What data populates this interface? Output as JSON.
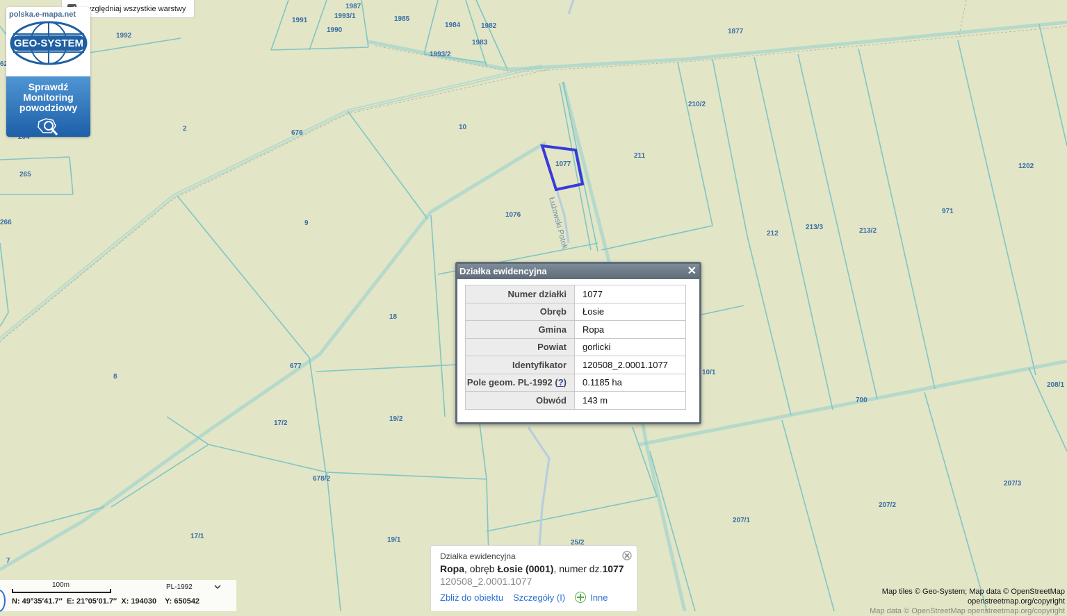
{
  "layers_toggle": {
    "label": "uwzględniaj wszystkie warstwy",
    "checked": true
  },
  "logo": {
    "site": "polska.e-mapa.net",
    "brand": "GEO-SYSTEM",
    "flood_lines": [
      "Sprawdź",
      "Monitoring",
      "powodziowy"
    ]
  },
  "map": {
    "parcel_labels": [
      {
        "id": "l1987",
        "t": "1987"
      },
      {
        "id": "l1993_1",
        "t": "1993/1"
      },
      {
        "id": "l1991",
        "t": "1991"
      },
      {
        "id": "l1990",
        "t": "1990"
      },
      {
        "id": "l1985",
        "t": "1985"
      },
      {
        "id": "l1984",
        "t": "1984"
      },
      {
        "id": "l1982",
        "t": "1982"
      },
      {
        "id": "l1983",
        "t": "1983"
      },
      {
        "id": "l1993_2",
        "t": "1993/2"
      },
      {
        "id": "l1877",
        "t": "1877"
      },
      {
        "id": "l1992",
        "t": "1992"
      },
      {
        "id": "l2",
        "t": "2"
      },
      {
        "id": "l676",
        "t": "676"
      },
      {
        "id": "l10",
        "t": "10"
      },
      {
        "id": "l210_2",
        "t": "210/2"
      },
      {
        "id": "l211",
        "t": "211"
      },
      {
        "id": "l1077",
        "t": "1077"
      },
      {
        "id": "l1202",
        "t": "1202"
      },
      {
        "id": "l265",
        "t": "265"
      },
      {
        "id": "l204",
        "t": "204"
      },
      {
        "id": "l266",
        "t": "266"
      },
      {
        "id": "l9",
        "t": "9"
      },
      {
        "id": "l1076",
        "t": "1076"
      },
      {
        "id": "l971",
        "t": "971"
      },
      {
        "id": "l212",
        "t": "212"
      },
      {
        "id": "l213_3",
        "t": "213/3"
      },
      {
        "id": "l213_2",
        "t": "213/2"
      },
      {
        "id": "l18",
        "t": "18"
      },
      {
        "id": "l677",
        "t": "677"
      },
      {
        "id": "l8",
        "t": "8"
      },
      {
        "id": "l10_1",
        "t": "10/1"
      },
      {
        "id": "l208_1",
        "t": "208/1"
      },
      {
        "id": "l700",
        "t": "700"
      },
      {
        "id": "l17_2",
        "t": "17/2"
      },
      {
        "id": "l19_2",
        "t": "19/2"
      },
      {
        "id": "l678_2",
        "t": "678/2"
      },
      {
        "id": "l207_3",
        "t": "207/3"
      },
      {
        "id": "l207_2",
        "t": "207/2"
      },
      {
        "id": "l207_1",
        "t": "207/1"
      },
      {
        "id": "l17_1",
        "t": "17/1"
      },
      {
        "id": "l19_1",
        "t": "19/1"
      },
      {
        "id": "l25_2",
        "t": "25/2"
      },
      {
        "id": "l7",
        "t": "7"
      },
      {
        "id": "l62",
        "t": "62"
      }
    ],
    "stream_name": "Łużowski Potok",
    "selected_parcel": "1077",
    "selection_color": "#3a3ad8"
  },
  "dialog": {
    "title": "Działka ewidencyjna",
    "rows": [
      {
        "key": "Numer działki",
        "value": "1077"
      },
      {
        "key": "Obręb",
        "value": "Łosie"
      },
      {
        "key": "Gmina",
        "value": "Ropa"
      },
      {
        "key": "Powiat",
        "value": "gorlicki"
      },
      {
        "key": "Identyfikator",
        "value": "120508_2.0001.1077"
      },
      {
        "key": "Pole geom. PL-1992",
        "value": "0.1185 ha",
        "help": "?"
      },
      {
        "key": "Obwód",
        "value": "143 m"
      }
    ]
  },
  "info_panel": {
    "heading": "Działka ewidencyjna",
    "gmina": "Ropa",
    "obreb_text": ", obręb ",
    "obreb": "Łosie (0001)",
    "numer_text": ", numer dz.",
    "numer": "1077",
    "identifier": "120508_2.0001.1077",
    "links": [
      "Zbliż do obiektu",
      "Szczegóły (I)",
      "Inne"
    ]
  },
  "scale": {
    "length": "100m",
    "projection": "PL-1992",
    "coords": "N: 49°35′41.7″  E: 21°05′01.7″  X: 194030    Y: 650542"
  },
  "attribution": {
    "line1": "Map tiles © Geo-System; Map data © OpenStreetMap",
    "line2": "openstreetmap.org/copyright",
    "ghost": "Map data © OpenStreetMap openstreetmap.org/copyright"
  }
}
